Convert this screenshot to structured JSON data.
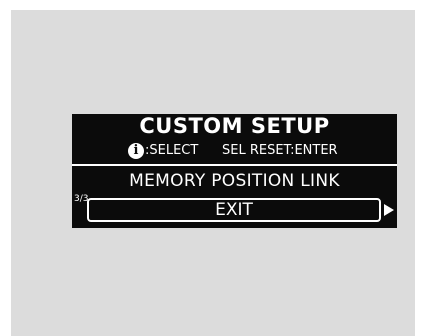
{
  "screen": {
    "title": "CUSTOM SETUP",
    "hint_select": ":SELECT",
    "hint_reset": "SEL RESET:ENTER",
    "info_icon_glyph": "i",
    "item_label": "MEMORY POSITION LINK",
    "page_indicator": "3/3",
    "exit_label": "EXIT",
    "next_arrow_icon": "triangle-right-icon"
  }
}
